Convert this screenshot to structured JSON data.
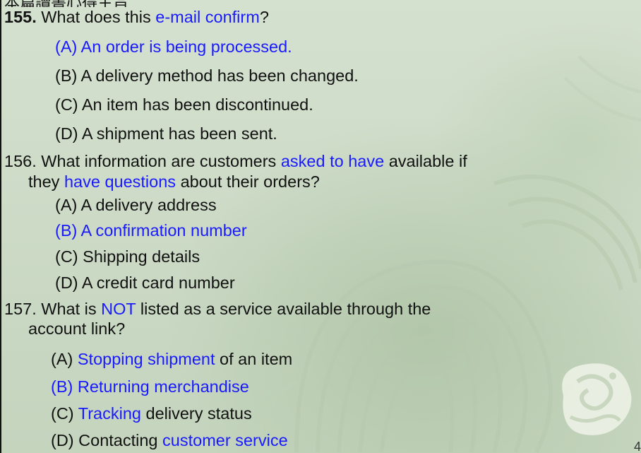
{
  "header_partial": "本篇讀書心得主旨",
  "q155": {
    "number": "155.",
    "t1": " What does this ",
    "t2": "e-mail confirm",
    "t3": "?",
    "A": "(A) An order is being processed.",
    "B": "(B) A delivery method has been changed.",
    "C": "(C) An item has been discontinued.",
    "D": "(D) A shipment has been sent."
  },
  "q156": {
    "t1": "156. What information are customers ",
    "t2": "asked to have",
    "t3": " available if",
    "l2a": "they ",
    "l2b": "have questions",
    "l2c": " about their orders?",
    "A": "(A) A delivery address",
    "B": "(B) A confirmation number",
    "C": "(C) Shipping details",
    "D": "(D) A credit card number"
  },
  "q157": {
    "t1": "157. What is ",
    "t2": "NOT",
    "t3": " listed as a service available through the",
    "l2": "account link?",
    "A1": "(A) ",
    "A2": "Stopping shipment",
    "A3": " of an item",
    "B": "(B) Returning merchandise",
    "C1": "(C) ",
    "C2": "Tracking",
    "C3": " delivery status",
    "D1": "(D) Contacting ",
    "D2": "customer service"
  },
  "page_number": "4",
  "colors": {
    "highlight": "#1a1aff",
    "text": "#111111",
    "background": "#cfdcc9"
  },
  "icons": {
    "decoration": "jade-dragon-ornament-icon"
  }
}
